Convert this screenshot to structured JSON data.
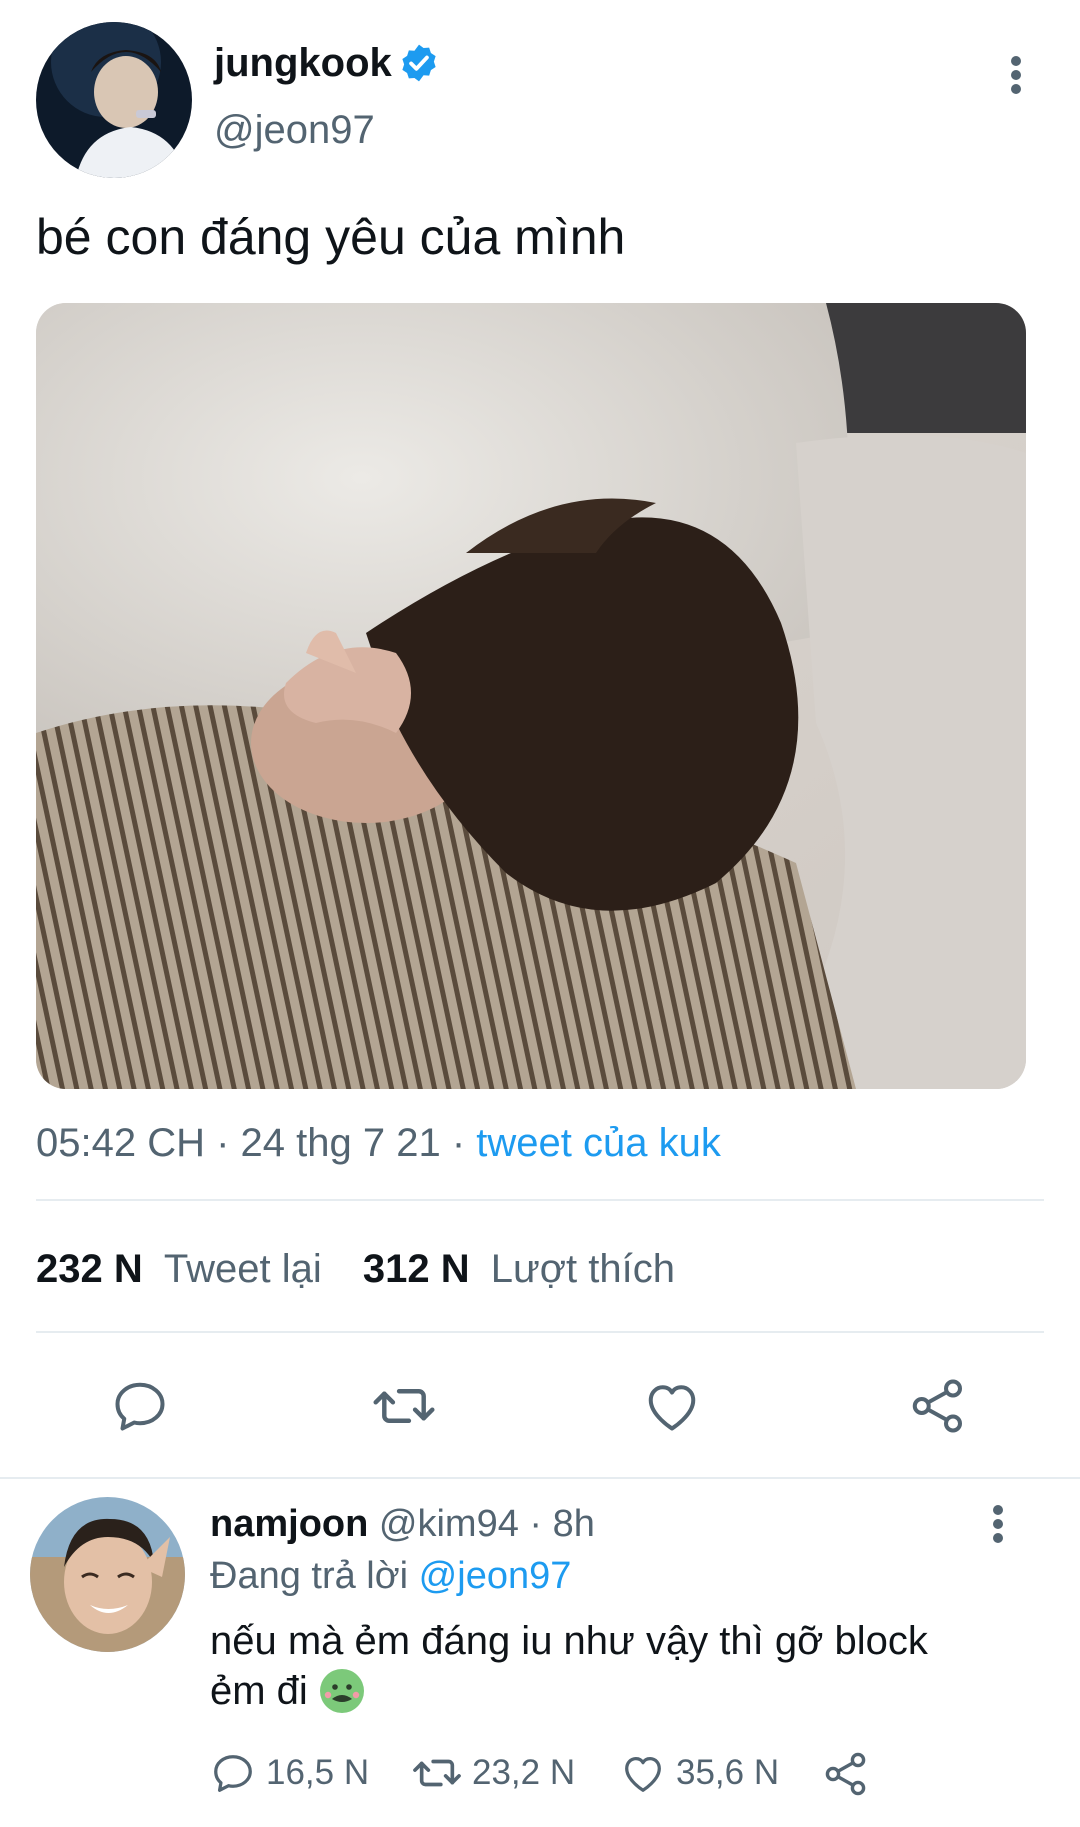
{
  "tweet": {
    "author_name": "jungkook",
    "author_handle": "@jeon97",
    "verified": true,
    "text": "bé con đáng yêu của mình",
    "time": "05:42 CH",
    "date": "24 thg 7 21",
    "source": "tweet của kuk",
    "stats": {
      "retweets_count": "232 N",
      "retweets_label": "Tweet lại",
      "likes_count": "312 N",
      "likes_label": "Lượt thích"
    }
  },
  "reply": {
    "author_name": "namjoon",
    "author_handle": "@kim94",
    "age": "8h",
    "replying_label": "Đang trả lời",
    "replying_to": "@jeon97",
    "text_line1": "nếu mà ẻm đáng iu như vậy thì gỡ block",
    "text_line2": "ẻm đi",
    "replies": "16,5 N",
    "retweets": "23,2 N",
    "likes": "35,6 N"
  },
  "colors": {
    "accent": "#1d9bf0",
    "secondary_text": "#536471",
    "divider": "#e6ecf0"
  }
}
